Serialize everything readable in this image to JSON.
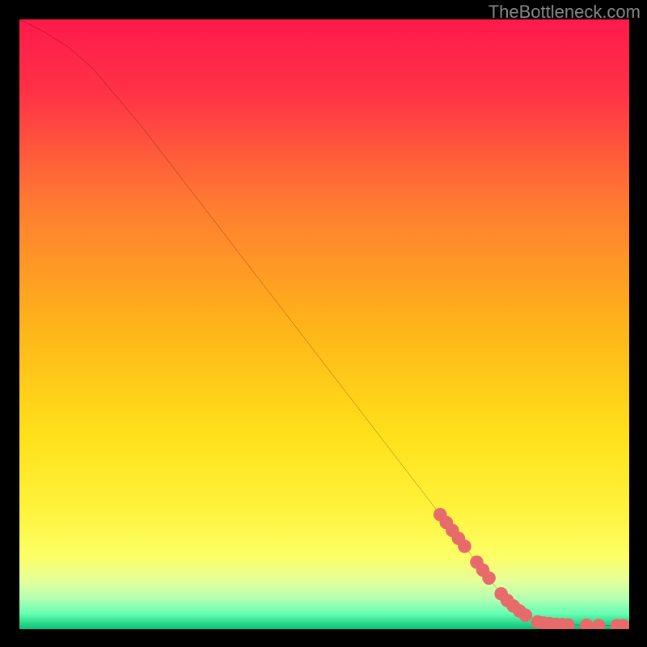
{
  "watermark": "TheBottleneck.com",
  "chart_data": {
    "type": "line",
    "title": "",
    "xlabel": "",
    "ylabel": "",
    "xlim": [
      0,
      100
    ],
    "ylim": [
      0,
      100
    ],
    "curve": [
      {
        "x": 0,
        "y": 100
      },
      {
        "x": 4,
        "y": 98
      },
      {
        "x": 8,
        "y": 95.5
      },
      {
        "x": 12,
        "y": 92
      },
      {
        "x": 20,
        "y": 82.5
      },
      {
        "x": 30,
        "y": 69.5
      },
      {
        "x": 40,
        "y": 56.5
      },
      {
        "x": 50,
        "y": 43.5
      },
      {
        "x": 60,
        "y": 30.5
      },
      {
        "x": 70,
        "y": 17.5
      },
      {
        "x": 78,
        "y": 7.0
      },
      {
        "x": 82,
        "y": 3.0
      },
      {
        "x": 85,
        "y": 1.2
      },
      {
        "x": 90,
        "y": 0.7
      },
      {
        "x": 95,
        "y": 0.6
      },
      {
        "x": 100,
        "y": 0.6
      }
    ],
    "markers": [
      {
        "x": 69,
        "y": 18.8
      },
      {
        "x": 70,
        "y": 17.5
      },
      {
        "x": 71,
        "y": 16.2
      },
      {
        "x": 72,
        "y": 14.9
      },
      {
        "x": 73,
        "y": 13.6
      },
      {
        "x": 75,
        "y": 11.0
      },
      {
        "x": 76,
        "y": 9.7
      },
      {
        "x": 77,
        "y": 8.4
      },
      {
        "x": 79,
        "y": 5.8
      },
      {
        "x": 80,
        "y": 4.7
      },
      {
        "x": 81,
        "y": 3.8
      },
      {
        "x": 82,
        "y": 3.0
      },
      {
        "x": 83,
        "y": 2.3
      },
      {
        "x": 85,
        "y": 1.2
      },
      {
        "x": 86,
        "y": 1.0
      },
      {
        "x": 87,
        "y": 0.9
      },
      {
        "x": 88,
        "y": 0.8
      },
      {
        "x": 89,
        "y": 0.75
      },
      {
        "x": 90,
        "y": 0.7
      },
      {
        "x": 93,
        "y": 0.65
      },
      {
        "x": 95,
        "y": 0.6
      },
      {
        "x": 98,
        "y": 0.6
      },
      {
        "x": 99,
        "y": 0.6
      }
    ],
    "marker_color": "#e86b6b",
    "curve_color": "#000000"
  }
}
